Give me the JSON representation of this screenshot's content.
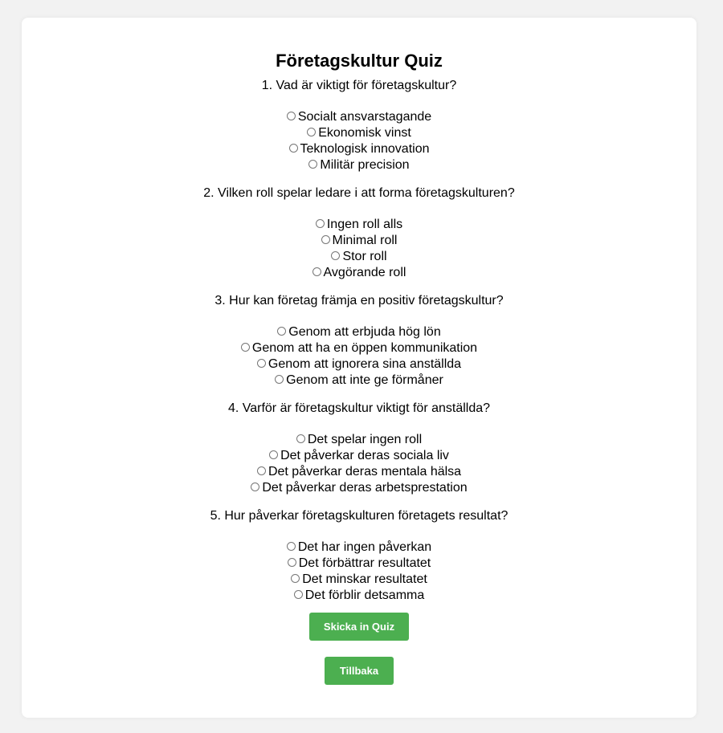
{
  "quiz": {
    "title": "Företagskultur Quiz",
    "questions": [
      {
        "text": "1. Vad är viktigt för företagskultur?",
        "options": [
          "Socialt ansvarstagande",
          "Ekonomisk vinst",
          "Teknologisk innovation",
          "Militär precision"
        ]
      },
      {
        "text": "2. Vilken roll spelar ledare i att forma företagskulturen?",
        "options": [
          "Ingen roll alls",
          "Minimal roll",
          "Stor roll",
          "Avgörande roll"
        ]
      },
      {
        "text": "3. Hur kan företag främja en positiv företagskultur?",
        "options": [
          "Genom att erbjuda hög lön",
          "Genom att ha en öppen kommunikation",
          "Genom att ignorera sina anställda",
          "Genom att inte ge förmåner"
        ]
      },
      {
        "text": "4. Varför är företagskultur viktigt för anställda?",
        "options": [
          "Det spelar ingen roll",
          "Det påverkar deras sociala liv",
          "Det påverkar deras mentala hälsa",
          "Det påverkar deras arbetsprestation"
        ]
      },
      {
        "text": "5. Hur påverkar företagskulturen företagets resultat?",
        "options": [
          "Det har ingen påverkan",
          "Det förbättrar resultatet",
          "Det minskar resultatet",
          "Det förblir detsamma"
        ]
      }
    ],
    "submit_label": "Skicka in Quiz",
    "back_label": "Tillbaka"
  },
  "colors": {
    "background": "#f2f2f2",
    "card": "#ffffff",
    "button": "#4caf50",
    "button_text": "#ffffff"
  }
}
